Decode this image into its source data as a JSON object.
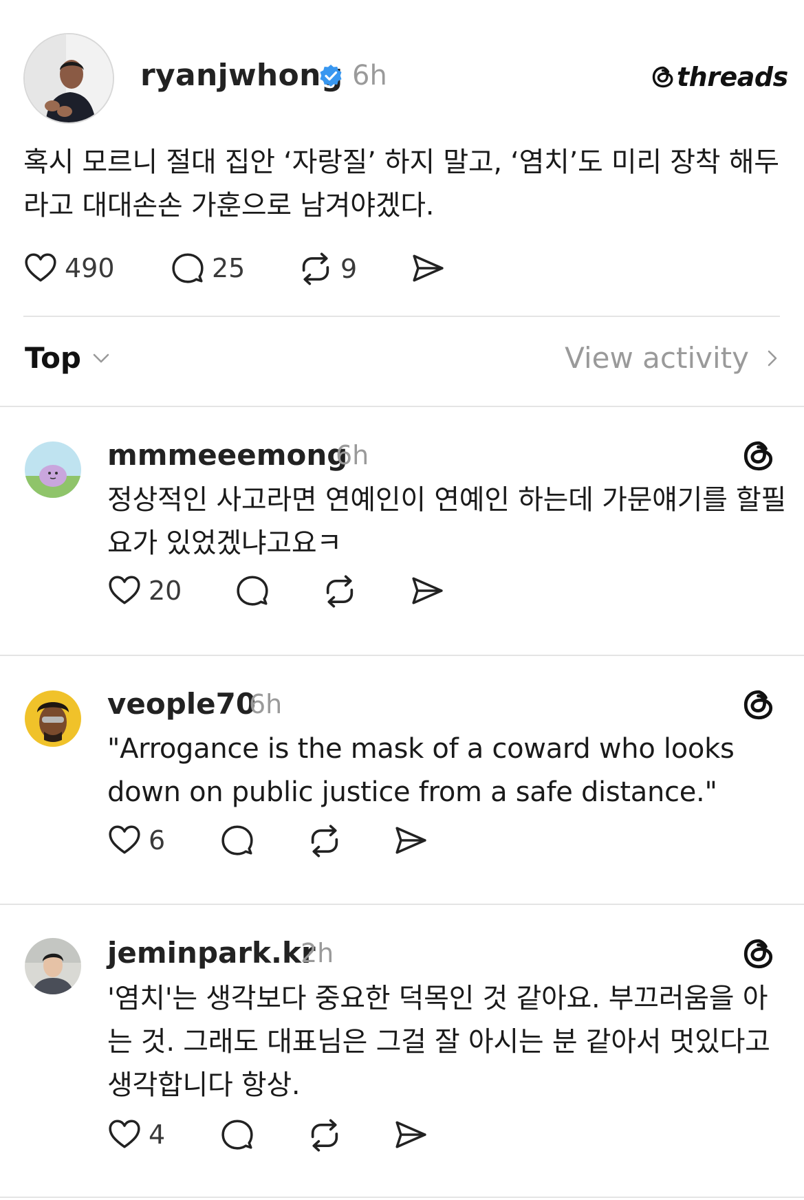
{
  "brand": {
    "name": "threads"
  },
  "post": {
    "author": "ryanjwhong",
    "verified": true,
    "time": "6h",
    "body": "혹시 모르니 절대 집안 ‘자랑질’ 하지 말고, ‘염치’도 미리 장착 해두라고 대대손손 가훈으로 남겨야겠다.",
    "likes": "490",
    "comments": "25",
    "reposts": "9"
  },
  "sort": {
    "label": "Top",
    "view_activity": "View activity"
  },
  "replies": [
    {
      "username": "mmmeeemong",
      "time": "6h",
      "body": "정상적인 사고라면 연예인이 연예인 하는데 가문얘기를 할필요가 있었겠냐고요ㅋ",
      "likes": "20"
    },
    {
      "username": "veople70",
      "time": "6h",
      "body": "\"Arrogance is the mask of a coward who looks down on public justice from a safe distance.\"",
      "likes": "6"
    },
    {
      "username": "jeminpark.kr",
      "time": "2h",
      "body": "'염치'는 생각보다 중요한 덕목인 것 같아요. 부끄러움을 아는 것. 그래도 대표님은 그걸 잘 아시는 분 같아서 멋있다고 생각합니다 항상.",
      "likes": "4"
    }
  ],
  "colors": {
    "verified_blue": "#3897f0",
    "muted_text": "#9a9a9a",
    "divider": "#e4e4e4"
  },
  "icons": [
    "heart-icon",
    "comment-icon",
    "repost-icon",
    "share-icon",
    "threads-logo-icon",
    "chevron-down-icon",
    "chevron-right-icon",
    "verified-badge-icon"
  ]
}
